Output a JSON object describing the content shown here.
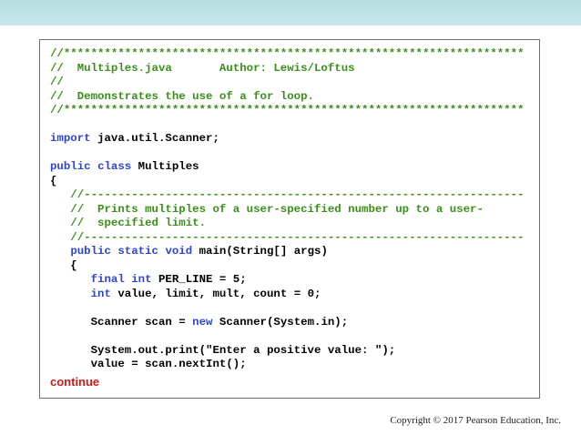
{
  "slide": {
    "continue_label": "continue",
    "copyright": "Copyright © 2017 Pearson Education, Inc."
  },
  "colors": {
    "comment": "#3a8f1a",
    "keyword": "#2e44d4",
    "continue": "#cc1c1c",
    "header_band": "#b5dde1"
  },
  "code": {
    "lines": [
      [
        {
          "t": "//********************************************************************",
          "c": "cm"
        }
      ],
      [
        {
          "t": "//  Multiples.java       Author: Lewis/Loftus",
          "c": "cm"
        }
      ],
      [
        {
          "t": "//",
          "c": "cm"
        }
      ],
      [
        {
          "t": "//  Demonstrates the use of a for loop.",
          "c": "cm"
        }
      ],
      [
        {
          "t": "//********************************************************************",
          "c": "cm"
        }
      ],
      [],
      [
        {
          "t": "import",
          "c": "kw"
        },
        {
          "t": " java.util.Scanner;",
          "c": "tx"
        }
      ],
      [],
      [
        {
          "t": "public",
          "c": "kw"
        },
        {
          "t": " ",
          "c": "tx"
        },
        {
          "t": "class",
          "c": "kw"
        },
        {
          "t": " Multiples",
          "c": "tx"
        }
      ],
      [
        {
          "t": "{",
          "c": "tx"
        }
      ],
      [
        {
          "t": "   //-----------------------------------------------------------------",
          "c": "cm"
        }
      ],
      [
        {
          "t": "   //  Prints multiples of a user-specified number up to a user-",
          "c": "cm"
        }
      ],
      [
        {
          "t": "   //  specified limit.",
          "c": "cm"
        }
      ],
      [
        {
          "t": "   //-----------------------------------------------------------------",
          "c": "cm"
        }
      ],
      [
        {
          "t": "   ",
          "c": "tx"
        },
        {
          "t": "public",
          "c": "kw"
        },
        {
          "t": " ",
          "c": "tx"
        },
        {
          "t": "static",
          "c": "kw"
        },
        {
          "t": " ",
          "c": "tx"
        },
        {
          "t": "void",
          "c": "kw"
        },
        {
          "t": " main(String[] args)",
          "c": "tx"
        }
      ],
      [
        {
          "t": "   {",
          "c": "tx"
        }
      ],
      [
        {
          "t": "      ",
          "c": "tx"
        },
        {
          "t": "final",
          "c": "kw"
        },
        {
          "t": " ",
          "c": "tx"
        },
        {
          "t": "int",
          "c": "kw"
        },
        {
          "t": " PER_LINE = 5;",
          "c": "tx"
        }
      ],
      [
        {
          "t": "      ",
          "c": "tx"
        },
        {
          "t": "int",
          "c": "kw"
        },
        {
          "t": " value, limit, mult, count = 0;",
          "c": "tx"
        }
      ],
      [],
      [
        {
          "t": "      Scanner scan = ",
          "c": "tx"
        },
        {
          "t": "new",
          "c": "kw"
        },
        {
          "t": " Scanner(System.in);",
          "c": "tx"
        }
      ],
      [],
      [
        {
          "t": "      System.out.print(\"Enter a positive value: \");",
          "c": "tx"
        }
      ],
      [
        {
          "t": "      value = scan.nextInt();",
          "c": "tx"
        }
      ]
    ]
  }
}
